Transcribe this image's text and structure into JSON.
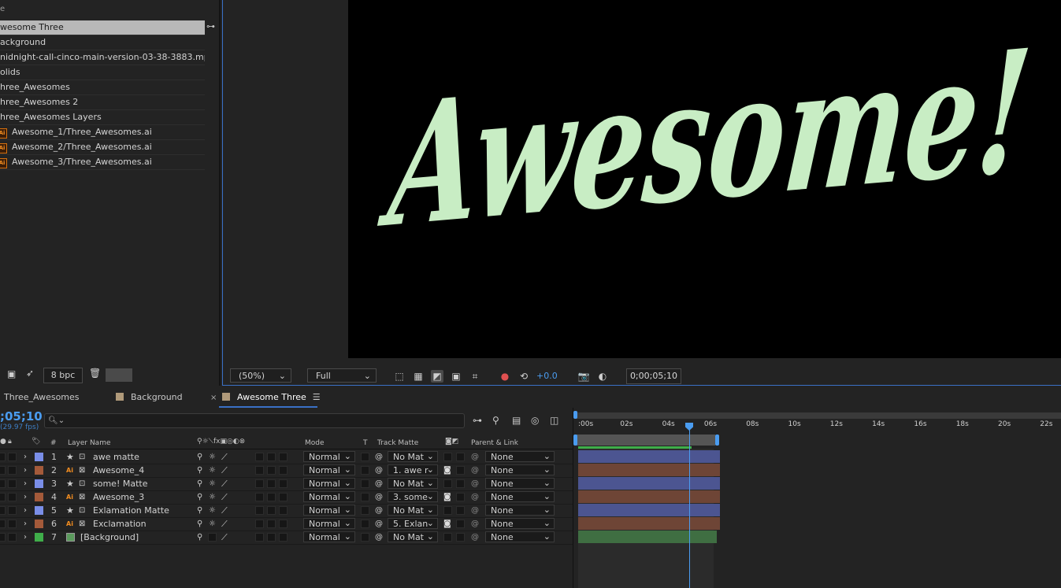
{
  "project": {
    "header": "e",
    "items": [
      {
        "label": "wesome Three",
        "type": "comp",
        "selected": true
      },
      {
        "label": "ackground",
        "type": "comp"
      },
      {
        "label": "nidnight-call-cinco-main-version-03-38-3883.mp3",
        "type": "audio"
      },
      {
        "label": "olids",
        "type": "folder"
      },
      {
        "label": "hree_Awesomes",
        "type": "comp"
      },
      {
        "label": "hree_Awesomes 2",
        "type": "comp"
      },
      {
        "label": "hree_Awesomes Layers",
        "type": "folder"
      },
      {
        "label": "Awesome_1/Three_Awesomes.ai",
        "type": "ai"
      },
      {
        "label": "Awesome_2/Three_Awesomes.ai",
        "type": "ai"
      },
      {
        "label": "Awesome_3/Three_Awesomes.ai",
        "type": "ai"
      }
    ],
    "bpc": "8 bpc"
  },
  "viewer": {
    "artwork_text": "Awesome!",
    "artwork_color": "#c8edc4",
    "zoom": "(50%)",
    "resolution": "Full",
    "exposure": "+0.0",
    "current_time": "0;00;05;10"
  },
  "tabs": [
    {
      "label": "Three_Awesomes",
      "active": false
    },
    {
      "label": "Background",
      "active": false
    },
    {
      "label": "Awesome Three",
      "active": true
    }
  ],
  "timeline": {
    "timecode": ";05;10",
    "fps": "(29.97 fps)",
    "columns": {
      "num": "#",
      "layer_name": "Layer Name",
      "mode": "Mode",
      "t": "T",
      "track_matte": "Track Matte",
      "parent_link": "Parent & Link"
    },
    "layers": [
      {
        "num": "1",
        "name": "awe matte",
        "type": "shape",
        "color": "#7a8ee8",
        "mode": "Normal",
        "matte": "No Mat",
        "matte_icon": false,
        "parent": "None",
        "bar_color": "#4c5591"
      },
      {
        "num": "2",
        "name": "Awesome_4",
        "type": "ai",
        "color": "#a45a3a",
        "mode": "Normal",
        "matte": "1. awe r",
        "matte_icon": true,
        "parent": "None",
        "bar_color": "#6e4536"
      },
      {
        "num": "3",
        "name": "some! Matte",
        "type": "shape",
        "color": "#7a8ee8",
        "mode": "Normal",
        "matte": "No Mat",
        "matte_icon": false,
        "parent": "None",
        "bar_color": "#4c5591"
      },
      {
        "num": "4",
        "name": "Awesome_3",
        "type": "ai",
        "color": "#a45a3a",
        "mode": "Normal",
        "matte": "3. some",
        "matte_icon": true,
        "parent": "None",
        "bar_color": "#6e4536"
      },
      {
        "num": "5",
        "name": "Exlamation Matte",
        "type": "shape",
        "color": "#7a8ee8",
        "mode": "Normal",
        "matte": "No Mat",
        "matte_icon": false,
        "parent": "None",
        "bar_color": "#4c5591"
      },
      {
        "num": "6",
        "name": "Exclamation",
        "type": "ai",
        "color": "#a45a3a",
        "mode": "Normal",
        "matte": "5. Exlan",
        "matte_icon": true,
        "parent": "None",
        "bar_color": "#6e4536"
      },
      {
        "num": "7",
        "name": "[Background]",
        "type": "solid",
        "color": "#3fae4a",
        "mode": "Normal",
        "matte": "No Mat",
        "matte_icon": false,
        "parent": "None",
        "bar_color": "#3f6e42"
      }
    ],
    "ruler": [
      ":00s",
      "02s",
      "04s",
      "06s",
      "08s",
      "10s",
      "12s",
      "14s",
      "16s",
      "18s",
      "20s",
      "22s"
    ],
    "playhead_seconds": 5.33
  }
}
